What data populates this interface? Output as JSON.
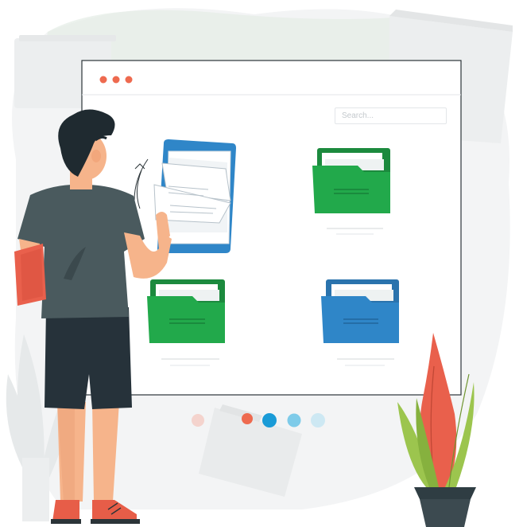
{
  "illustration": {
    "search": {
      "placeholder": "Search..."
    },
    "colors": {
      "background": "#f3f4f5",
      "accent_blue": "#2f86c8",
      "folder_green": "#22a94b",
      "window_dot": "#ee6a4f",
      "pager_active": "#1a9bd7",
      "pager_mid": "#7ecbe9",
      "pager_light": "#cde8f3",
      "plant_red": "#e9604c",
      "plant_green": "#9cc54e",
      "shirt": "#4a5a5e",
      "shorts": "#26323a",
      "skin": "#f6b48b",
      "hair": "#1f2a30",
      "shoe": "#e75d48"
    },
    "icons": [
      "window-dots-icon",
      "open-book-icon",
      "green-folder-icon",
      "blue-folder-icon",
      "plant-icon",
      "person-figure"
    ],
    "pager": {
      "pages": 5,
      "active": 3
    }
  }
}
